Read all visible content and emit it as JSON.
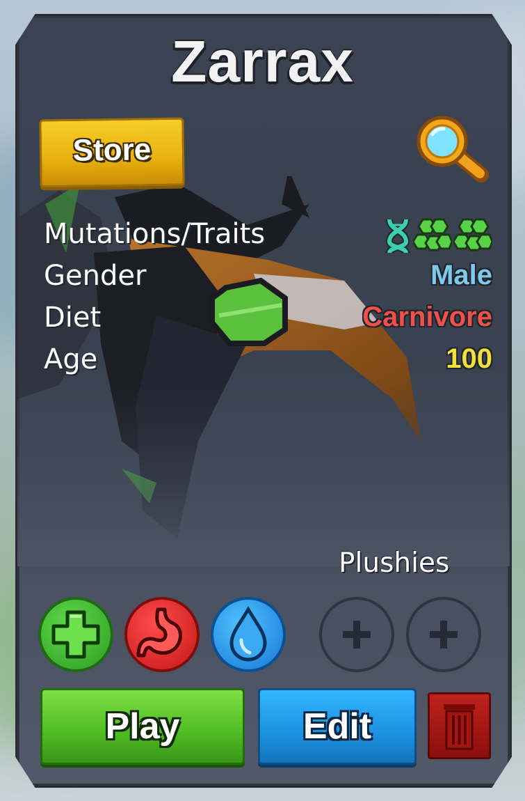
{
  "card": {
    "title": "Zarrax",
    "store_label": "Store"
  },
  "stats": [
    {
      "label": "Mutations/Traits",
      "value": "",
      "color": "#ffffff"
    },
    {
      "label": "Gender",
      "value": "Male",
      "color": "#7ec8ea"
    },
    {
      "label": "Diet",
      "value": "Carnivore",
      "color": "#f0504a"
    },
    {
      "label": "Age",
      "value": "100",
      "color": "#f4e03a"
    }
  ],
  "traits": {
    "icons": [
      "dna-icon",
      "mutation-cluster-icon",
      "mutation-cluster-icon"
    ],
    "color": "#3dbfa0",
    "cluster_color": "#4fd04a"
  },
  "plushies": {
    "label": "Plushies",
    "slots": [
      "plus-icon",
      "plus-icon"
    ]
  },
  "needs": {
    "icons": [
      "heal-plus-icon",
      "stomach-icon",
      "water-drop-icon"
    ],
    "colors": [
      "#3fbd2e",
      "#e42a2a",
      "#2a95ec"
    ]
  },
  "actions": {
    "play_label": "Play",
    "edit_label": "Edit",
    "delete_icon": "trash-icon"
  }
}
